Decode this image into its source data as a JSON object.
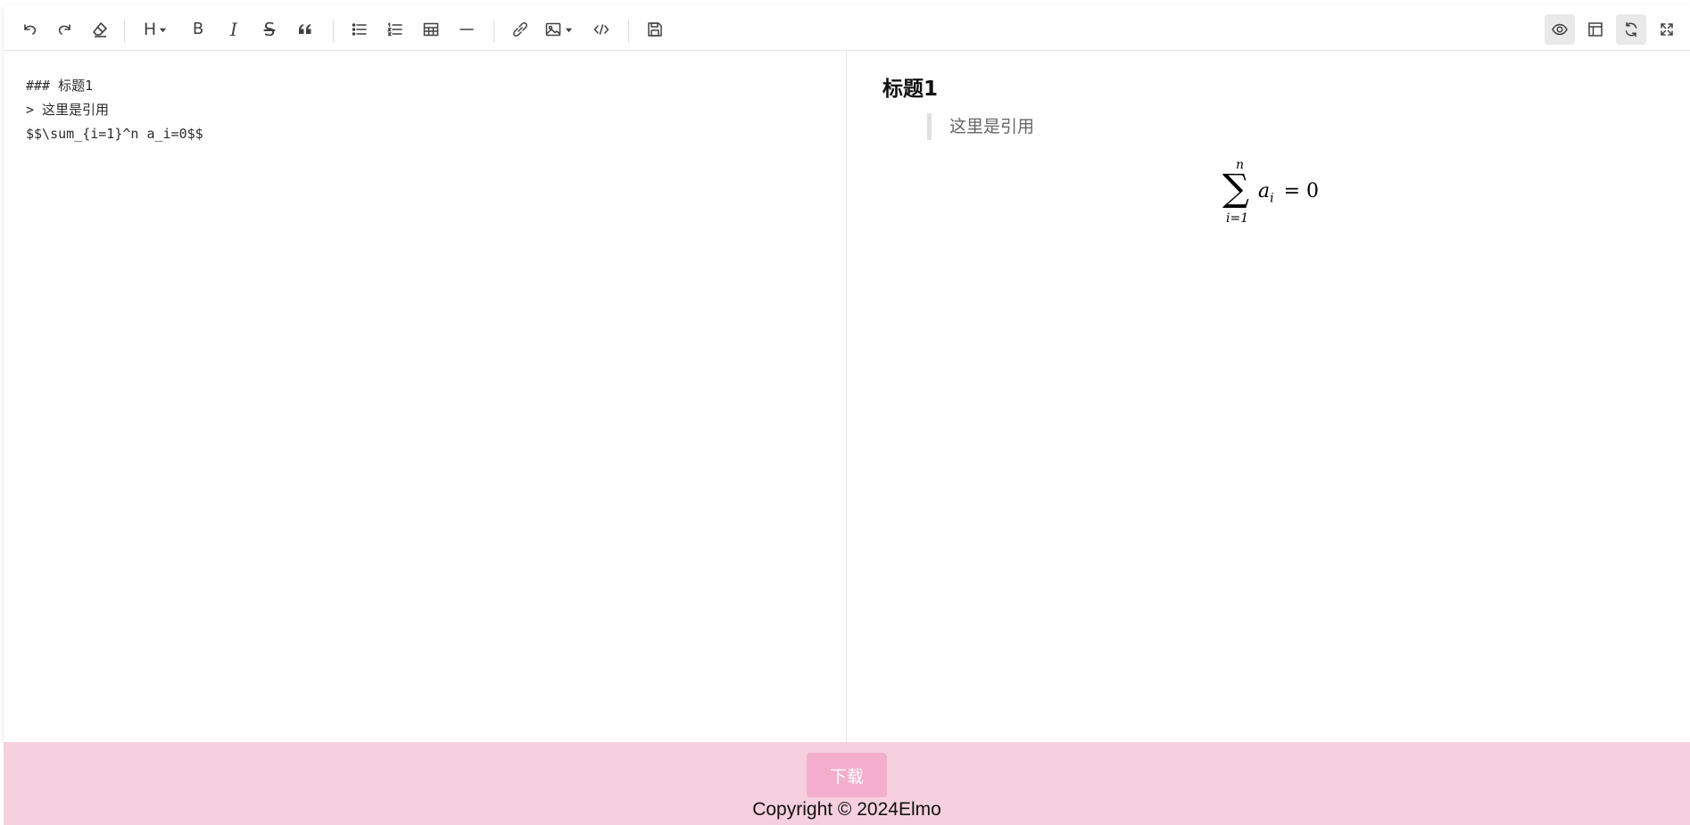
{
  "toolbar": {
    "left_buttons": [
      {
        "icon": "undo-icon",
        "title": "undo"
      },
      {
        "icon": "redo-icon",
        "title": "redo"
      },
      {
        "icon": "eraser-icon",
        "title": "clear"
      },
      {
        "icon": "heading-icon",
        "title": "heading",
        "glyph": "H"
      },
      {
        "icon": "bold-icon",
        "title": "bold",
        "glyph": "B"
      },
      {
        "icon": "italic-icon",
        "title": "italic",
        "glyph": "I"
      },
      {
        "icon": "strikethrough-icon",
        "title": "strikethrough",
        "glyph": "S"
      },
      {
        "icon": "quote-icon",
        "title": "quote"
      },
      {
        "icon": "unordered-list-icon",
        "title": "unordered list"
      },
      {
        "icon": "ordered-list-icon",
        "title": "ordered list"
      },
      {
        "icon": "table-icon",
        "title": "table"
      },
      {
        "icon": "horizontal-rule-icon",
        "title": "horizontal rule"
      },
      {
        "icon": "link-icon",
        "title": "link"
      },
      {
        "icon": "image-icon",
        "title": "image"
      },
      {
        "icon": "code-icon",
        "title": "code"
      },
      {
        "icon": "save-icon",
        "title": "save"
      }
    ],
    "right_buttons": [
      {
        "icon": "eye-icon",
        "title": "preview",
        "active": true
      },
      {
        "icon": "layout-icon",
        "title": "toc",
        "active": false
      },
      {
        "icon": "sync-scroll-icon",
        "title": "sync scroll",
        "active": true
      },
      {
        "icon": "fullscreen-icon",
        "title": "fullscreen",
        "active": false
      }
    ]
  },
  "editor": {
    "lines": [
      "### 标题1",
      "> 这里是引用",
      "$$\\sum_{i=1}^n a_i=0$$"
    ]
  },
  "preview": {
    "heading": "标题1",
    "blockquote": "这里是引用",
    "math": {
      "operator": "∑",
      "upper": "n",
      "lower": "i=1",
      "term": "a",
      "subscript": "i",
      "rhs": "= 0"
    }
  },
  "footer": {
    "download_label": "下载",
    "copyright": "Copyright © 2024Elmo"
  },
  "colors": {
    "footer_bg": "#f6d0de",
    "download_bg": "#f3aecd",
    "quote_border": "#e0e0e0"
  }
}
